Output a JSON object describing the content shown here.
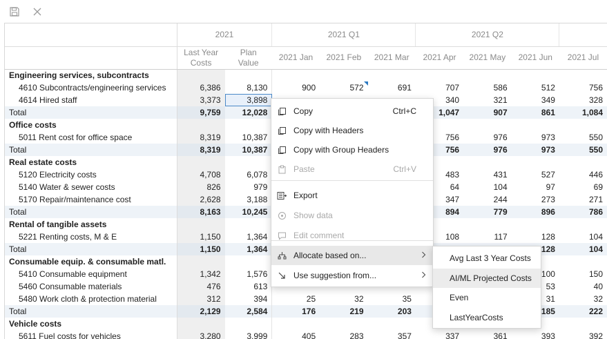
{
  "toolbar": {
    "save_icon": "save-icon",
    "close_icon": "close-icon"
  },
  "header": {
    "groups": [
      "2021",
      "2021 Q1",
      "2021 Q2"
    ],
    "columns": [
      [
        "Last Year",
        "Costs"
      ],
      [
        "Plan",
        "Value"
      ],
      [
        "2021 Jan"
      ],
      [
        "2021 Feb"
      ],
      [
        "2021 Mar"
      ],
      [
        "2021 Apr"
      ],
      [
        "2021 May"
      ],
      [
        "2021 Jun"
      ],
      [
        "2021 Jul"
      ]
    ]
  },
  "rows": [
    {
      "type": "section",
      "label": "Engineering services, subcontracts",
      "values": []
    },
    {
      "type": "item",
      "label": "4610 Subcontracts/engineering services",
      "values": [
        "6,386",
        "8,130",
        "900",
        "572",
        "691",
        "707",
        "586",
        "512",
        "756"
      ]
    },
    {
      "type": "item",
      "label": "4614 Hired staff",
      "values": [
        "3,373",
        "3,898",
        "",
        "",
        "",
        "340",
        "321",
        "349",
        "328"
      ]
    },
    {
      "type": "total",
      "label": "Total",
      "values": [
        "9,759",
        "12,028",
        "",
        "",
        "",
        "1,047",
        "907",
        "861",
        "1,084"
      ]
    },
    {
      "type": "section",
      "label": "Office costs",
      "values": []
    },
    {
      "type": "item",
      "label": "5011 Rent cost for office space",
      "values": [
        "8,319",
        "10,387",
        "",
        "",
        "",
        "756",
        "976",
        "973",
        "550"
      ]
    },
    {
      "type": "total",
      "label": "Total",
      "values": [
        "8,319",
        "10,387",
        "",
        "",
        "",
        "756",
        "976",
        "973",
        "550"
      ]
    },
    {
      "type": "section",
      "label": "Real estate costs",
      "values": []
    },
    {
      "type": "item",
      "label": "5120 Electricity costs",
      "values": [
        "4,708",
        "6,078",
        "",
        "",
        "",
        "483",
        "431",
        "527",
        "446"
      ]
    },
    {
      "type": "item",
      "label": "5140 Water & sewer costs",
      "values": [
        "826",
        "979",
        "",
        "",
        "",
        "64",
        "104",
        "97",
        "69"
      ]
    },
    {
      "type": "item",
      "label": "5170 Repair/maintenance cost",
      "values": [
        "2,628",
        "3,188",
        "",
        "",
        "",
        "347",
        "244",
        "273",
        "271"
      ]
    },
    {
      "type": "total",
      "label": "Total",
      "values": [
        "8,163",
        "10,245",
        "",
        "",
        "",
        "894",
        "779",
        "896",
        "786"
      ]
    },
    {
      "type": "section",
      "label": "Rental of tangible assets",
      "values": []
    },
    {
      "type": "item",
      "label": "5221 Renting costs, M & E",
      "values": [
        "1,150",
        "1,364",
        "",
        "",
        "",
        "108",
        "117",
        "128",
        "104"
      ]
    },
    {
      "type": "total",
      "label": "Total",
      "values": [
        "1,150",
        "1,364",
        "",
        "",
        "",
        "",
        "",
        "128",
        "104"
      ]
    },
    {
      "type": "section",
      "label": "Consumable equip. & consumable matl.",
      "values": []
    },
    {
      "type": "item",
      "label": "5410 Consumable equipment",
      "values": [
        "1,342",
        "1,576",
        "",
        "",
        "",
        "",
        "",
        "100",
        "150"
      ]
    },
    {
      "type": "item",
      "label": "5460 Consumable materials",
      "values": [
        "476",
        "613",
        "",
        "",
        "",
        "",
        "",
        "53",
        "40"
      ]
    },
    {
      "type": "item",
      "label": "5480 Work cloth & protection material",
      "values": [
        "312",
        "394",
        "25",
        "32",
        "35",
        "",
        "",
        "31",
        "32"
      ]
    },
    {
      "type": "total",
      "label": "Total",
      "values": [
        "2,129",
        "2,584",
        "176",
        "219",
        "203",
        "",
        "",
        "185",
        "222"
      ]
    },
    {
      "type": "section",
      "label": "Vehicle costs",
      "values": []
    },
    {
      "type": "item",
      "label": "5611 Fuel costs for vehicles",
      "values": [
        "3,280",
        "3,999",
        "405",
        "283",
        "357",
        "337",
        "361",
        "393",
        "392"
      ]
    }
  ],
  "context_menu": {
    "items": [
      {
        "label": "Copy",
        "shortcut": "Ctrl+C",
        "icon": "copy-icon",
        "disabled": false
      },
      {
        "label": "Copy with Headers",
        "shortcut": "",
        "icon": "copy-icon",
        "disabled": false
      },
      {
        "label": "Copy with Group Headers",
        "shortcut": "",
        "icon": "copy-icon",
        "disabled": false
      },
      {
        "label": "Paste",
        "shortcut": "Ctrl+V",
        "icon": "paste-icon",
        "disabled": true
      },
      {
        "label": "Export",
        "shortcut": "",
        "icon": "export-icon",
        "disabled": false
      },
      {
        "label": "Show data",
        "shortcut": "",
        "icon": "show-data-icon",
        "disabled": true
      },
      {
        "label": "Edit comment",
        "shortcut": "",
        "icon": "comment-icon",
        "disabled": true
      },
      {
        "label": "Allocate based on...",
        "shortcut": "",
        "icon": "allocate-icon",
        "disabled": false,
        "submenu": true
      },
      {
        "label": "Use suggestion from...",
        "shortcut": "",
        "icon": "suggestion-icon",
        "disabled": false,
        "submenu": true
      }
    ]
  },
  "submenu": {
    "items": [
      "Avg Last 3 Year Costs",
      "AI/ML Projected Costs",
      "Even",
      "LastYearCosts"
    ]
  }
}
